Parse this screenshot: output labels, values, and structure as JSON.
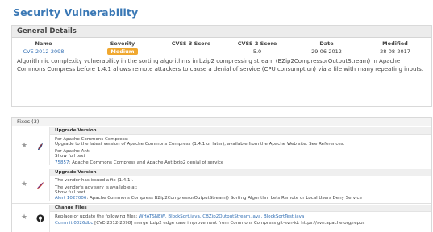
{
  "page": {
    "title": "Security Vulnerability"
  },
  "general": {
    "header": "General Details",
    "columns": [
      "Name",
      "Severity",
      "CVSS 3 Score",
      "CVSS 2 Score",
      "Date",
      "Modified"
    ],
    "row": {
      "name": "CVE-2012-2098",
      "severity": "Medium",
      "cvss3": "-",
      "cvss2": "5.0",
      "date": "29-06-2012",
      "modified": "28-08-2017"
    },
    "severity_color": "#f0a830",
    "description": "Algorithmic complexity vulnerability in the sorting algorithms in bzip2 compressing stream (BZip2CompressorOutputStream) in Apache Commons Compress before 1.4.1 allows remote attackers to cause a denial of service (CPU consumption) via a file with many repeating inputs."
  },
  "fixes": {
    "header": "Fixes (3)",
    "items": [
      {
        "icon": "apache-feather-icon",
        "title": "Upgrade Version",
        "lines": [
          "For Apache Commons Compress:",
          "Upgrade to the latest version of Apache Commons Compress (1.4.1 or later), available from the Apache Web site. See References.",
          "For Apache Ant:",
          "Show full text"
        ],
        "ref_id": "75857",
        "ref_text": ": Apache Commons Compress and Apache Ant bzip2 denial of service"
      },
      {
        "icon": "vendor-feather-icon",
        "title": "Upgrade Version",
        "lines": [
          "The vendor has issued a fix (1.4.1).",
          "The vendor's advisory is available at:",
          "Show full text"
        ],
        "ref_id": "Alert 1027006",
        "ref_text": ": Apache Commons Compress BZip2CompressorOutputStream() Sorting Algorithm Lets Remote or Local Users Deny Service"
      },
      {
        "icon": "github-icon",
        "title": "Change Files",
        "lines": [
          "Replace or update the following files: "
        ],
        "files": "WHATSNEW, BlockSort.java, CBZip2OutputStream.java, BlockSortTest.java",
        "ref_id": "Commit 0026dbc",
        "ref_text": " [CVE-2012-2098] merge bzip2 edge case improvement from Commons Compress git-svn-id: https://svn.apache.org/repos"
      }
    ]
  },
  "colors": {
    "title": "#3a78b5",
    "link": "#2f6db3",
    "badge": "#f0a830"
  }
}
